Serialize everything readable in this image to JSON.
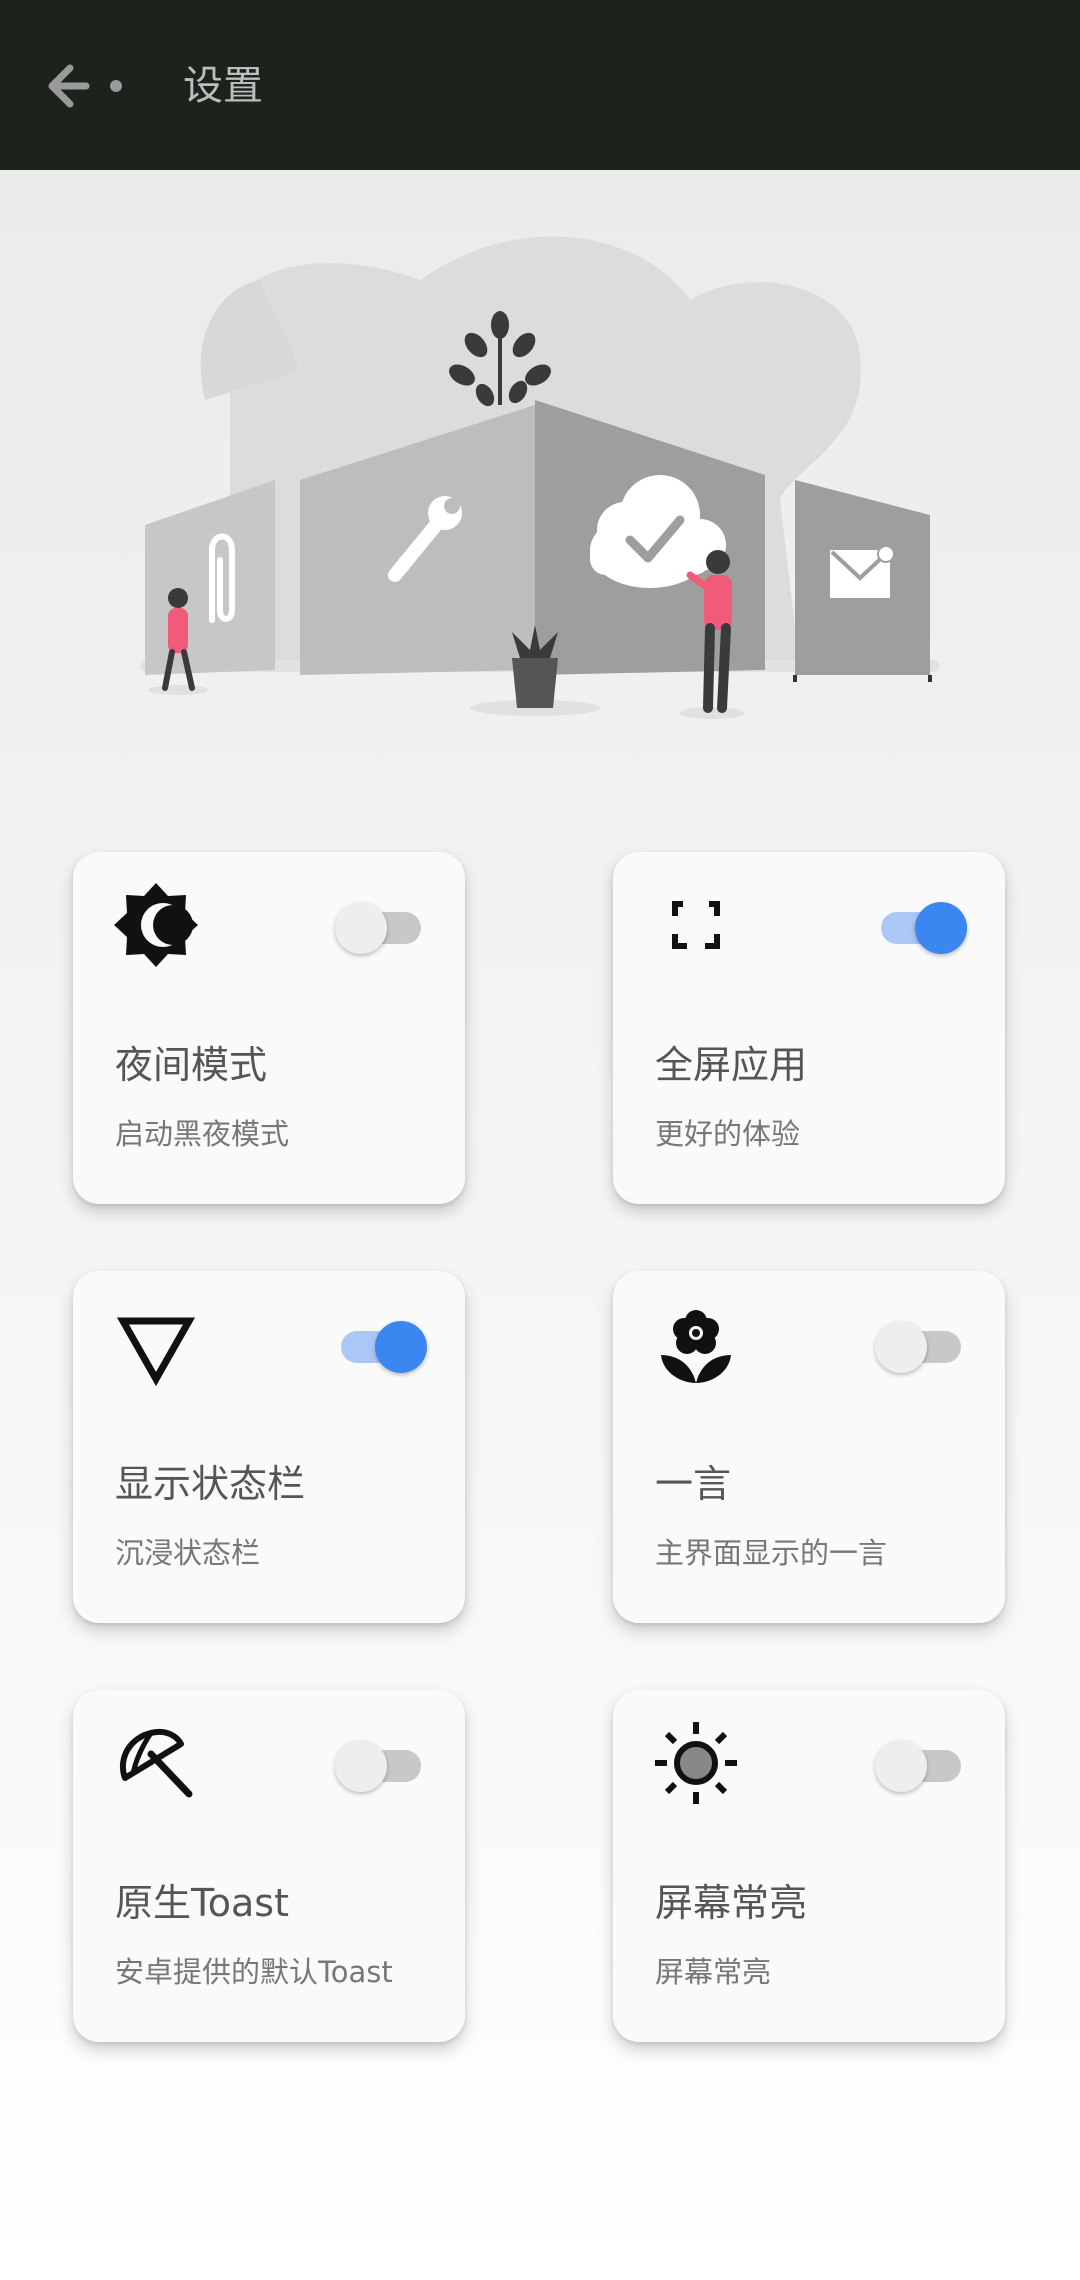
{
  "toolbar": {
    "title": "设置",
    "back_icon": "arrow-back-icon"
  },
  "colors": {
    "toolbar_bg": "#1b231c",
    "accent": "#3b87f1",
    "card_bg": "#fafafa",
    "illustration_pink": "#ef5b78"
  },
  "cards": [
    {
      "label": "夜间模式",
      "sub": "启动黑夜模式",
      "icon": "night-mode-icon",
      "enabled": false
    },
    {
      "label": "全屏应用",
      "sub": "更好的体验",
      "icon": "fullscreen-icon",
      "enabled": true
    },
    {
      "label": "显示状态栏",
      "sub": "沉浸状态栏",
      "icon": "triangle-icon",
      "enabled": true
    },
    {
      "label": "一言",
      "sub": "主界面显示的一言",
      "icon": "flower-icon",
      "enabled": false
    },
    {
      "label": "原生Toast",
      "sub": "安卓提供的默认Toast",
      "icon": "umbrella-icon",
      "enabled": false
    },
    {
      "label": "屏幕常亮",
      "sub": "屏幕常亮",
      "icon": "brightness-icon",
      "enabled": false
    }
  ]
}
